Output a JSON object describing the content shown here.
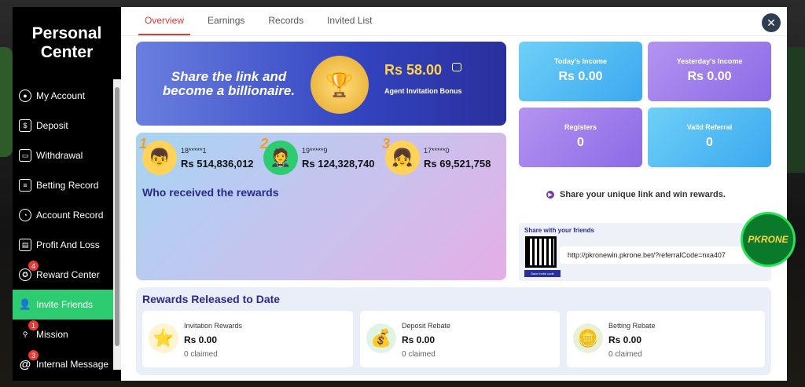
{
  "sidebar": {
    "title_line1": "Personal",
    "title_line2": "Center",
    "items": [
      {
        "label": "My Account"
      },
      {
        "label": "Deposit"
      },
      {
        "label": "Withdrawal"
      },
      {
        "label": "Betting Record"
      },
      {
        "label": "Account Record"
      },
      {
        "label": "Profit And Loss"
      },
      {
        "label": "Reward Center",
        "badge": "4"
      },
      {
        "label": "Invite Friends",
        "active": true
      },
      {
        "label": "Mission",
        "badge": "1"
      },
      {
        "label": "Internal Message",
        "badge": "3"
      }
    ]
  },
  "tabs": [
    {
      "label": "Overview",
      "active": true
    },
    {
      "label": "Earnings"
    },
    {
      "label": "Records"
    },
    {
      "label": "Invited List"
    }
  ],
  "banner": {
    "slogan_line1": "Share the link and",
    "slogan_line2": "become a billionaire.",
    "amount": "Rs  58.00",
    "bonus_label": "Agent Invitation Bonus"
  },
  "winners": {
    "title": "Who received the rewards",
    "list": [
      {
        "rank": "1",
        "id": "18*****1",
        "amount": "Rs  514,836,012"
      },
      {
        "rank": "2",
        "id": "19*****9",
        "amount": "Rs  124,328,740"
      },
      {
        "rank": "3",
        "id": "17*****0",
        "amount": "Rs  69,521,758"
      }
    ]
  },
  "stats": {
    "today_label": "Today's Income",
    "today_value": "Rs  0.00",
    "yesterday_label": "Yesterday's Income",
    "yesterday_value": "Rs  0.00",
    "registers_label": "Registers",
    "registers_value": "0",
    "valid_label": "Valid Referral",
    "valid_value": "0"
  },
  "share": {
    "tagline": "Share your unique link and win rewards.",
    "heading": "Share with your friends",
    "qr_button": "Save Invite code",
    "url": "http://pkronewin.pkrone.bet/?referralCode=nxa407"
  },
  "logo_text": "PKRONE",
  "released": {
    "title": "Rewards Released to Date",
    "items": [
      {
        "label": "Invitation Rewards",
        "value": "Rs  0.00",
        "claimed": "0 claimed",
        "icon": "star-hand-icon"
      },
      {
        "label": "Deposit Rebate",
        "value": "Rs  0.00",
        "claimed": "0 claimed",
        "icon": "money-bag-icon"
      },
      {
        "label": "Betting Rebate",
        "value": "Rs  0.00",
        "claimed": "0 claimed",
        "icon": "coins-icon"
      }
    ]
  },
  "colors": {
    "accent_red": "#e53935",
    "active_green": "#2ecc71",
    "navy": "#2a2a8a"
  }
}
